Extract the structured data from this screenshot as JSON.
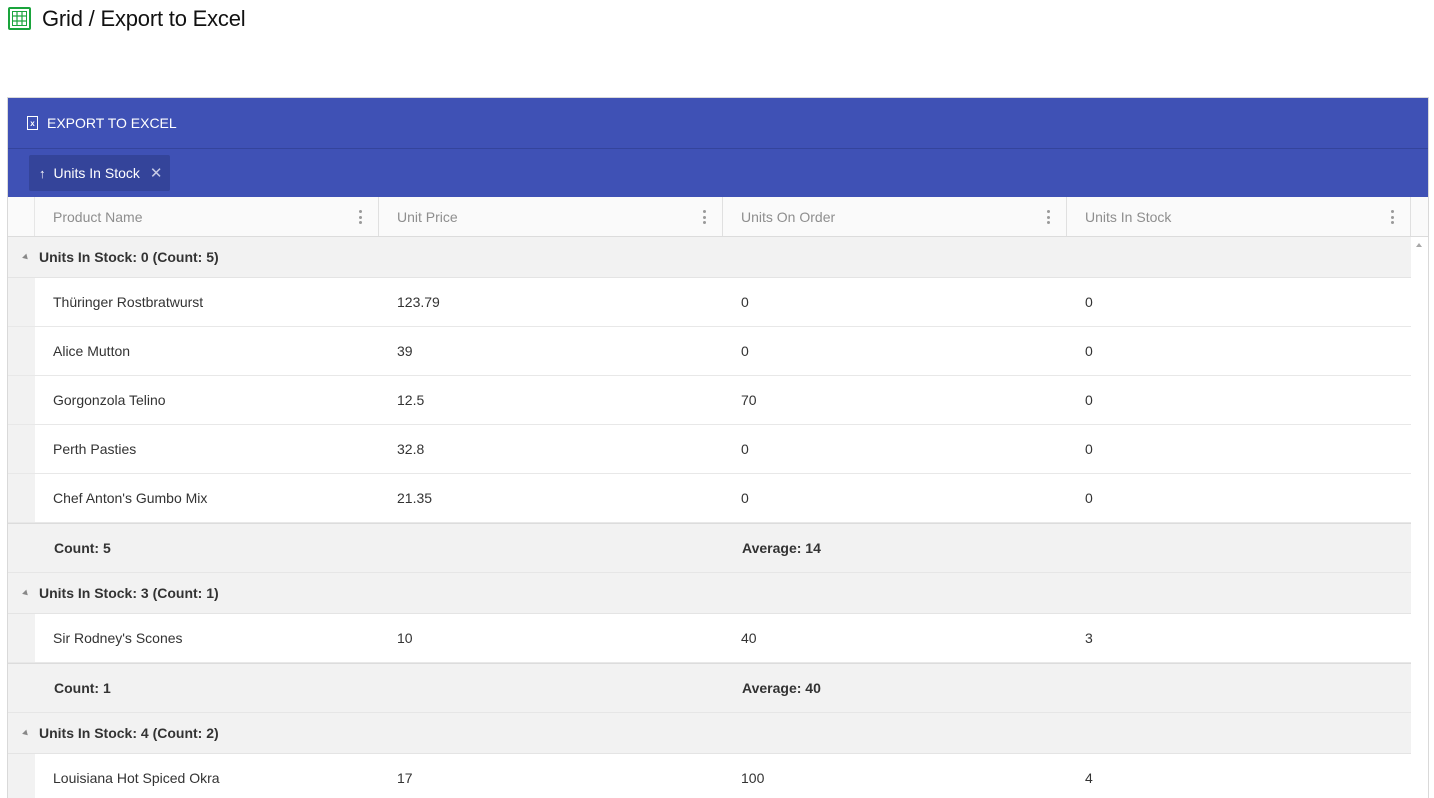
{
  "page": {
    "title": "Grid / Export to Excel"
  },
  "toolbar": {
    "export_label": "EXPORT TO EXCEL",
    "accent_color": "#3f51b5"
  },
  "group_panel": {
    "chip_label": "Units In Stock"
  },
  "columns": [
    "Product Name",
    "Unit Price",
    "Units On Order",
    "Units In Stock"
  ],
  "groups": [
    {
      "header": "Units In Stock: 0 (Count: 5)",
      "rows": [
        [
          "Thüringer Rostbratwurst",
          "123.79",
          "0",
          "0"
        ],
        [
          "Alice Mutton",
          "39",
          "0",
          "0"
        ],
        [
          "Gorgonzola Telino",
          "12.5",
          "70",
          "0"
        ],
        [
          "Perth Pasties",
          "32.8",
          "0",
          "0"
        ],
        [
          "Chef Anton's Gumbo Mix",
          "21.35",
          "0",
          "0"
        ]
      ],
      "footer": {
        "count": "Count: 5",
        "average": "Average: 14"
      }
    },
    {
      "header": "Units In Stock: 3 (Count: 1)",
      "rows": [
        [
          "Sir Rodney's Scones",
          "10",
          "40",
          "3"
        ]
      ],
      "footer": {
        "count": "Count: 1",
        "average": "Average: 40"
      }
    },
    {
      "header": "Units In Stock: 4 (Count: 2)",
      "rows": [
        [
          "Louisiana Hot Spiced Okra",
          "17",
          "100",
          "4"
        ]
      ]
    }
  ]
}
